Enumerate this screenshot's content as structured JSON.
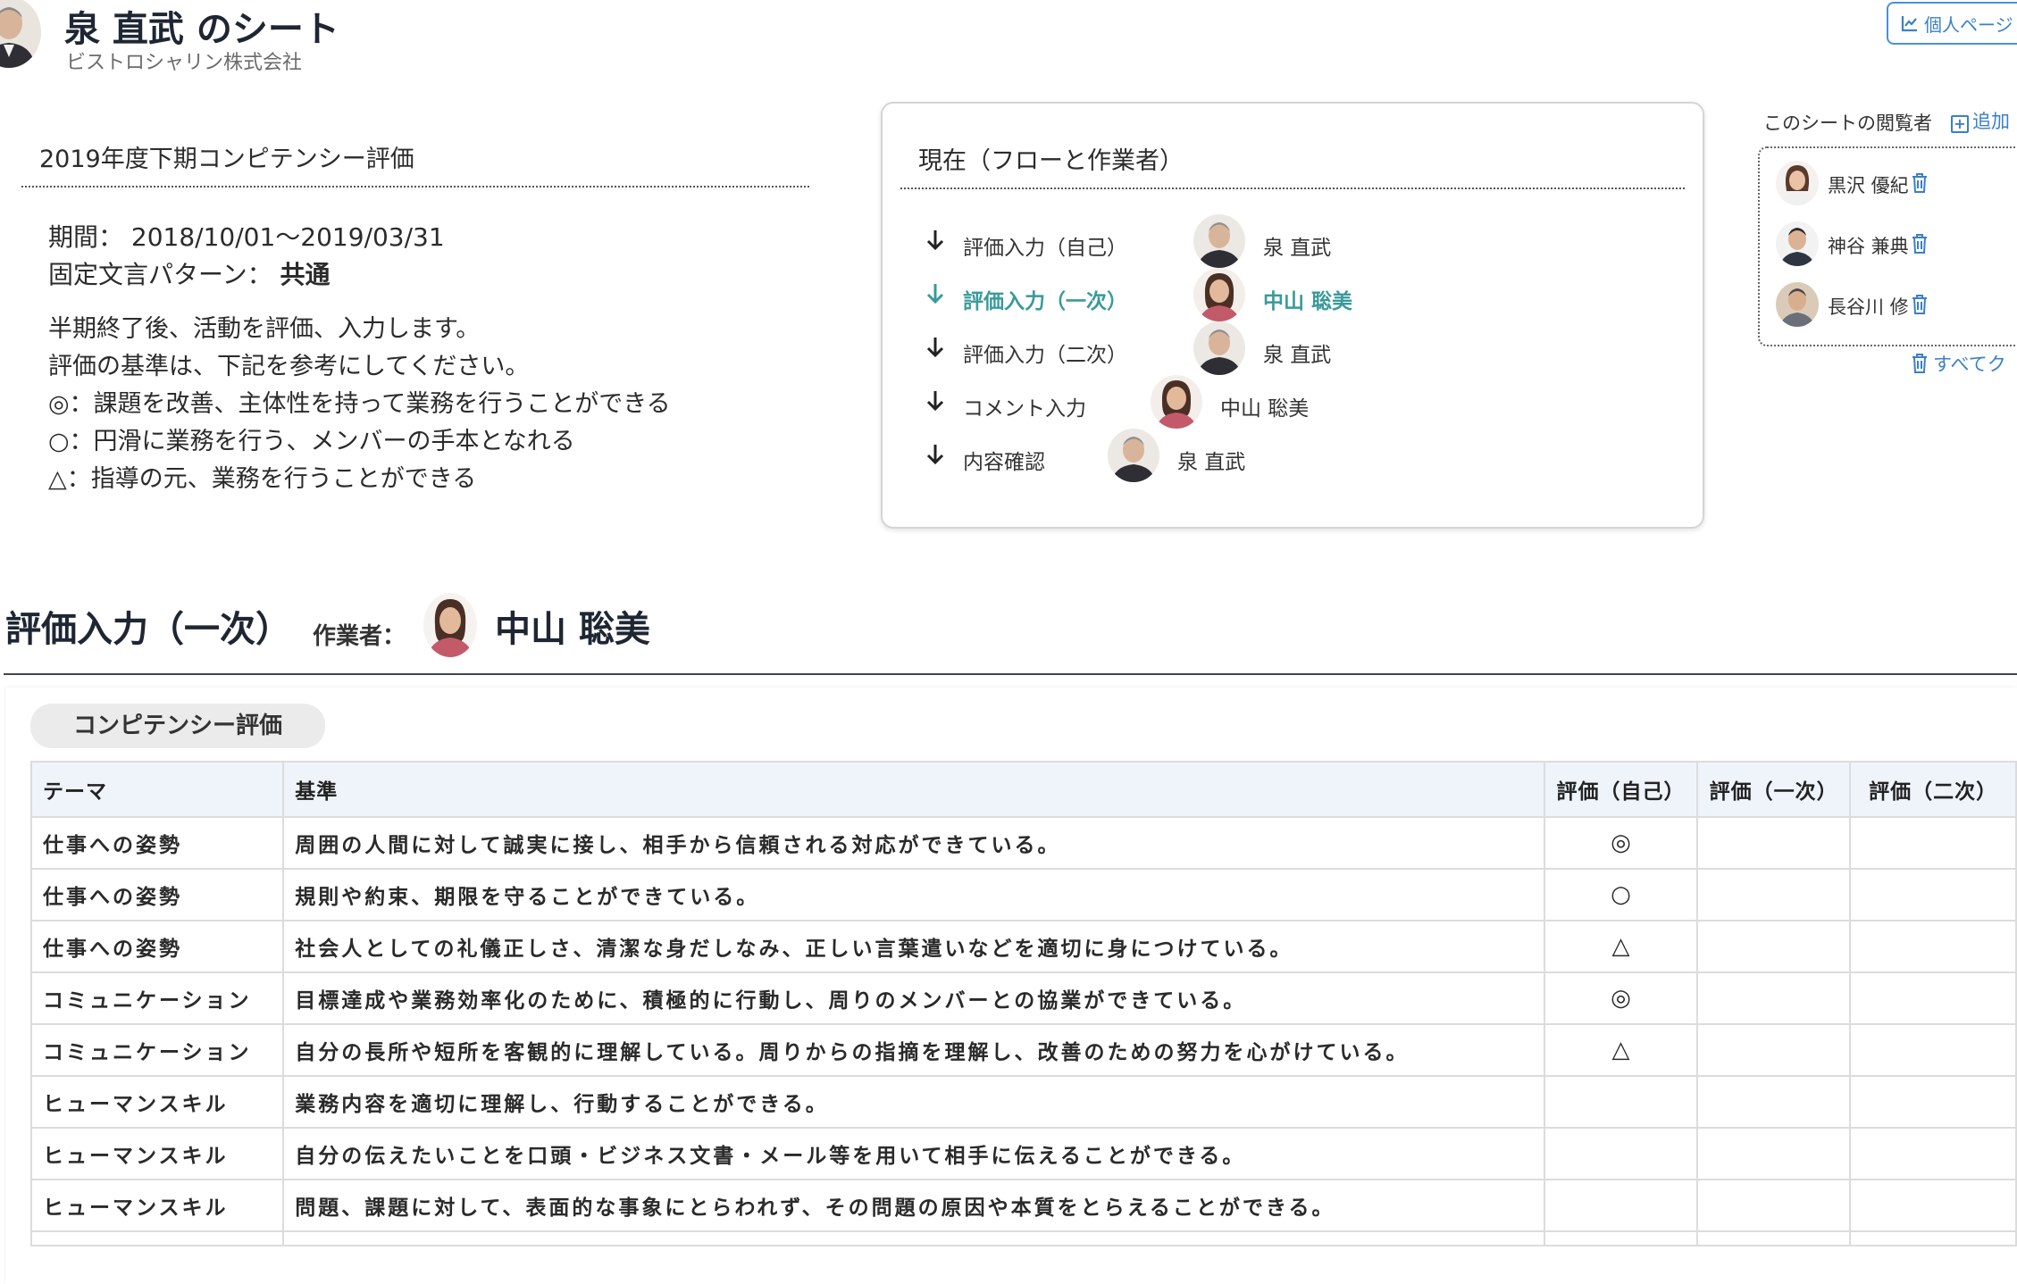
{
  "header": {
    "title": "泉 直武 のシート",
    "company": "ビストロシャリン株式会社",
    "personal_page_label": "個人ページ"
  },
  "evaluation": {
    "name": "2019年度下期コンピテンシー評価",
    "period_label": "期間：",
    "period_value": "2018/10/01〜2019/03/31",
    "pattern_label": "固定文言パターン：",
    "pattern_value": "共通",
    "description_lines": [
      "半期終了後、活動を評価、入力します。",
      "評価の基準は、下記を参考にしてください。",
      "◎：課題を改善、主体性を持って業務を行うことができる",
      "○：円滑に業務を行う、メンバーの手本となれる",
      "△：指導の元、業務を行うことができる"
    ]
  },
  "flow": {
    "title": "現在（フローと作業者）",
    "steps": [
      {
        "label": "評価入力（自己）",
        "person": "泉 直武",
        "active": false
      },
      {
        "label": "評価入力（一次）",
        "person": "中山 聡美",
        "active": true
      },
      {
        "label": "評価入力（二次）",
        "person": "泉 直武",
        "active": false
      },
      {
        "label": "コメント入力",
        "person": "中山 聡美",
        "active": false
      },
      {
        "label": "内容確認",
        "person": "泉 直武",
        "active": false
      }
    ],
    "active_color": "#3a9a9a"
  },
  "viewers": {
    "heading": "このシートの閲覧者",
    "add_label": "追加",
    "people": [
      "黒沢 優紀",
      "神谷 兼典",
      "長谷川 修"
    ],
    "remove_all_label": "すべてク"
  },
  "current_step": {
    "title": "評価入力（一次）",
    "worker_label": "作業者：",
    "worker_name": "中山 聡美"
  },
  "table": {
    "tab_label": "コンピテンシー評価",
    "headers": [
      "テーマ",
      "基準",
      "評価（自己）",
      "評価（一次）",
      "評価（二次）"
    ],
    "rows": [
      {
        "theme": "仕事への姿勢",
        "criterion": "周囲の人間に対して誠実に接し、相手から信頼される対応ができている。",
        "self": "◎",
        "first": "",
        "second": ""
      },
      {
        "theme": "仕事への姿勢",
        "criterion": "規則や約束、期限を守ることができている。",
        "self": "○",
        "first": "",
        "second": ""
      },
      {
        "theme": "仕事への姿勢",
        "criterion": "社会人としての礼儀正しさ、清潔な身だしなみ、正しい言葉遣いなどを適切に身につけている。",
        "self": "△",
        "first": "",
        "second": ""
      },
      {
        "theme": "コミュニケーション",
        "criterion": "目標達成や業務効率化のために、積極的に行動し、周りのメンバーとの協業ができている。",
        "self": "◎",
        "first": "",
        "second": ""
      },
      {
        "theme": "コミュニケーション",
        "criterion": "自分の長所や短所を客観的に理解している。周りからの指摘を理解し、改善のための努力を心がけている。",
        "self": "△",
        "first": "",
        "second": ""
      },
      {
        "theme": "ヒューマンスキル",
        "criterion": "業務内容を適切に理解し、行動することができる。",
        "self": "",
        "first": "",
        "second": ""
      },
      {
        "theme": "ヒューマンスキル",
        "criterion": "自分の伝えたいことを口頭・ビジネス文書・メール等を用いて相手に伝えることができる。",
        "self": "",
        "first": "",
        "second": ""
      },
      {
        "theme": "ヒューマンスキル",
        "criterion": "問題、課題に対して、表面的な事象にとらわれず、その問題の原因や本質をとらえることができる。",
        "self": "",
        "first": "",
        "second": ""
      }
    ]
  },
  "icons": {
    "avatar": "person-photo-icon",
    "arrow": "arrow-down-icon",
    "trash": "trash-icon",
    "chart": "chart-icon",
    "add": "plus-square-icon"
  },
  "colors": {
    "accent_blue": "#3a7fc8",
    "active_teal": "#3a9a9a",
    "header_bg": "#eef4fa"
  }
}
